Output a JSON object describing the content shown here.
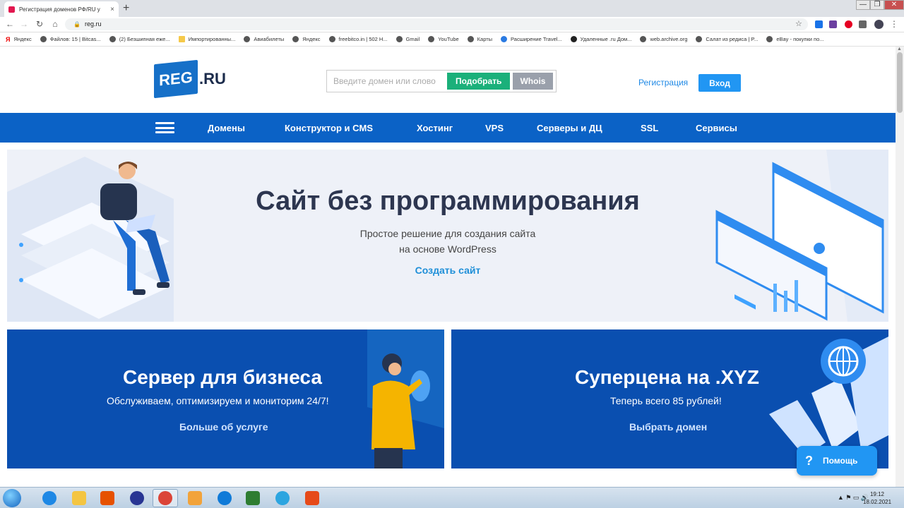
{
  "browser": {
    "tab_title": "Регистрация доменов РФ/RU у",
    "tab_close": "×",
    "new_tab": "+",
    "url": "reg.ru",
    "window_controls": [
      "—",
      "❐",
      "✕"
    ],
    "bookmarks": [
      {
        "label": "Яндекс",
        "icon": "yandex-icon"
      },
      {
        "label": "Файлов: 15 | Bitcas...",
        "icon": "globe-icon"
      },
      {
        "label": "(2) Безшипная еже...",
        "icon": "globe-icon"
      },
      {
        "label": "Импортированны...",
        "icon": "folder-icon"
      },
      {
        "label": "Авиабилеты",
        "icon": "globe-icon"
      },
      {
        "label": "Яндекс",
        "icon": "globe-icon"
      },
      {
        "label": "freebitco.in | 502 H...",
        "icon": "globe-icon"
      },
      {
        "label": "Gmail",
        "icon": "globe-icon"
      },
      {
        "label": "YouTube",
        "icon": "globe-icon"
      },
      {
        "label": "Карты",
        "icon": "globe-icon"
      },
      {
        "label": "Расширение Travel...",
        "icon": "globe-icon"
      },
      {
        "label": "Удаленные .ru Дом...",
        "icon": "globe-icon"
      },
      {
        "label": "web.archive.org",
        "icon": "globe-icon"
      },
      {
        "label": "Салат из редиса | Р...",
        "icon": "globe-icon"
      },
      {
        "label": "eBay - покупки по...",
        "icon": "globe-icon"
      }
    ]
  },
  "header": {
    "logo_text": "REG",
    "logo_suffix": ".RU",
    "search_placeholder": "Введите домен или слово",
    "pick_button": "Подобрать",
    "whois_button": "Whois",
    "register_link": "Регистрация",
    "login_button": "Вход"
  },
  "nav": {
    "items": [
      "Домены",
      "Конструктор и CMS",
      "Хостинг",
      "VPS",
      "Серверы и ДЦ",
      "SSL",
      "Сервисы"
    ]
  },
  "hero": {
    "title": "Сайт без программирования",
    "subtitle_line1": "Простое решение для создания сайта",
    "subtitle_line2": "на основе WordPress",
    "link": "Создать сайт"
  },
  "promos": [
    {
      "title": "Сервер для бизнеса",
      "subtitle": "Обслуживаем, оптимизируем и мониторим 24/7!",
      "link": "Больше об услуге"
    },
    {
      "title": "Суперцена на .XYZ",
      "subtitle": "Теперь всего 85 рублей!",
      "link": "Выбрать домен"
    }
  ],
  "help_widget": {
    "icon": "?",
    "label": "Помощь"
  },
  "taskbar": {
    "apps": [
      "ie-icon",
      "explorer-icon",
      "media-player-icon",
      "firefox-icon",
      "chrome-icon",
      "paint-icon",
      "edge-icon",
      "game-icon",
      "telegram-icon",
      "app-icon"
    ],
    "time": "19:12",
    "date": "18.02.2021"
  },
  "colors": {
    "brand_blue": "#0b62c6",
    "promo_blue": "#0a4fb0",
    "green": "#1bb07a",
    "accent_link": "#1e8fd8"
  }
}
